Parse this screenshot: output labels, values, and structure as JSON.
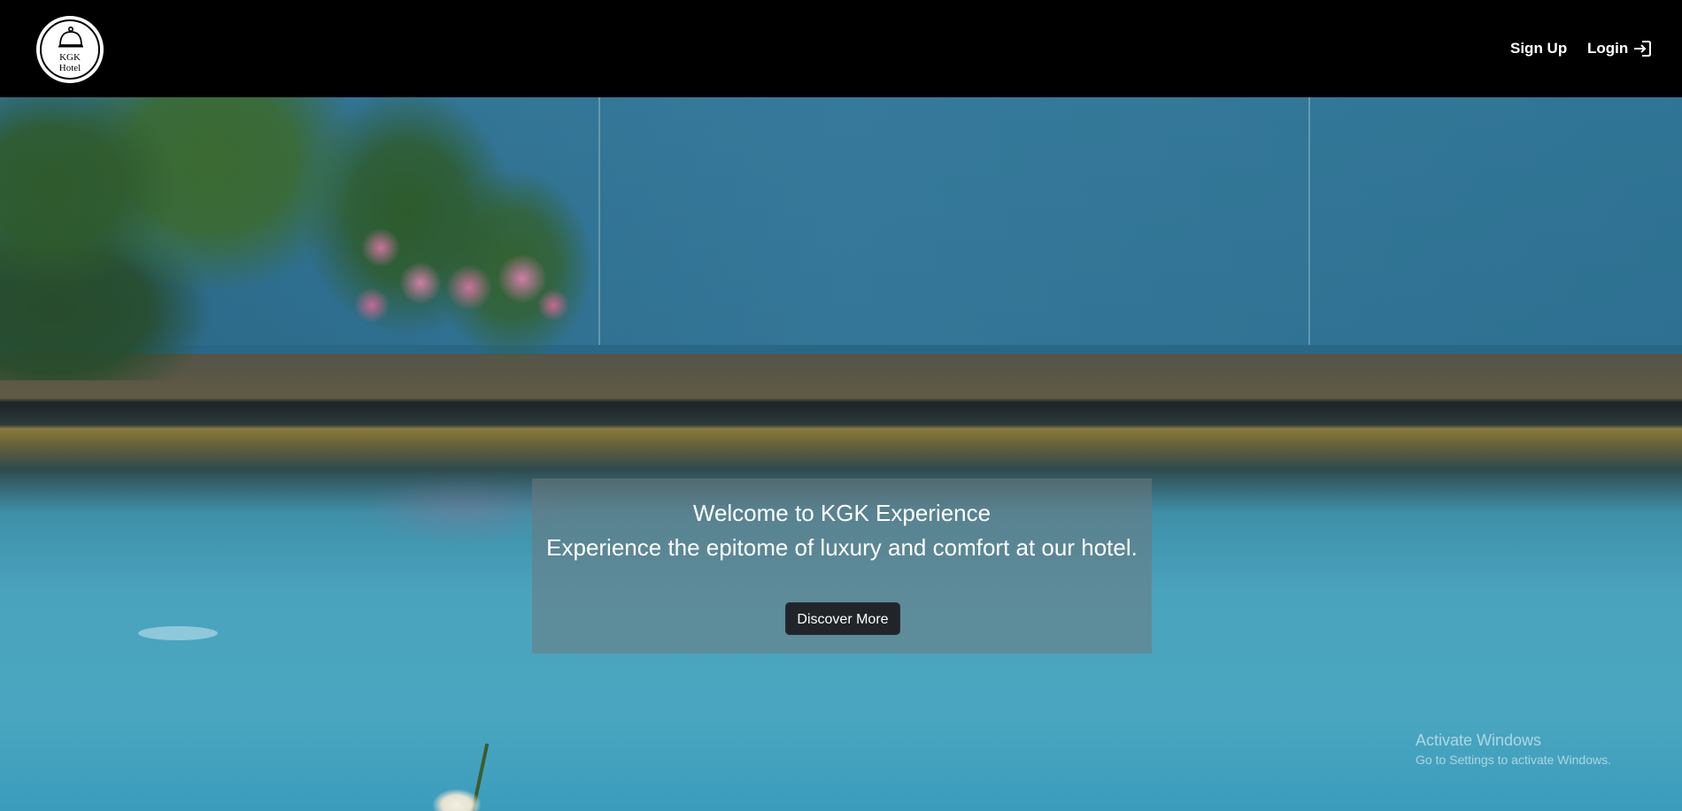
{
  "header": {
    "logo": {
      "line1": "KGK",
      "line2": "Hotel",
      "icon": "cloche-icon"
    },
    "nav": {
      "signup_label": "Sign Up",
      "login_label": "Login",
      "login_icon": "login-arrow-icon"
    }
  },
  "hero": {
    "title": "Welcome to KGK Experience",
    "subtitle": "Experience the epitome of luxury and comfort at our hotel.",
    "cta_label": "Discover More"
  },
  "watermark": {
    "line1": "Activate Windows",
    "line2": "Go to Settings to activate Windows."
  },
  "colors": {
    "navbar_bg": "#000000",
    "button_bg": "#212529",
    "text": "#ffffff"
  }
}
